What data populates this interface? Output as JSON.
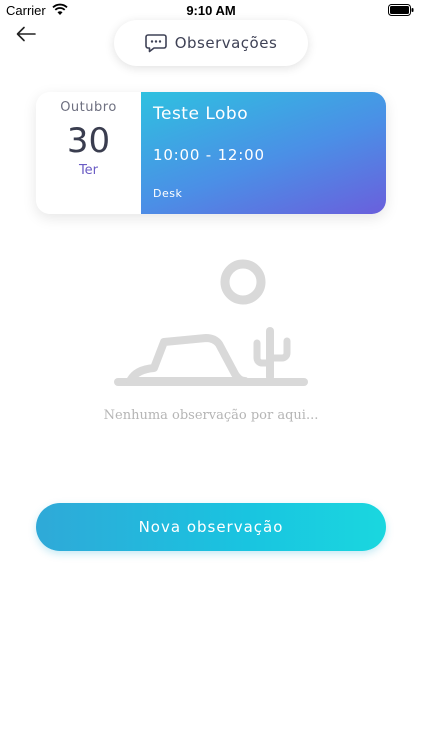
{
  "status_bar": {
    "carrier": "Carrier",
    "time": "9:10 AM"
  },
  "header": {
    "title": "Observações",
    "back_icon": "arrow-left-icon",
    "title_icon": "chat-bubble-icon"
  },
  "event": {
    "month": "Outubro",
    "day": "30",
    "weekday": "Ter",
    "title": "Teste Lobo",
    "time_range": "10:00 - 12:00",
    "location": "Desk"
  },
  "empty_state": {
    "illustration": "desert-landscape-icon",
    "message": "Nenhuma observação por aqui..."
  },
  "actions": {
    "new_note_label": "Nova observação"
  },
  "colors": {
    "accent_purple": "#6a5bc4",
    "gradient_start": "#2ec1e0",
    "gradient_end": "#6a5fdc",
    "button_start": "#2fa9d8",
    "button_end": "#1ad7df",
    "placeholder_gray": "#d9d9d9"
  }
}
